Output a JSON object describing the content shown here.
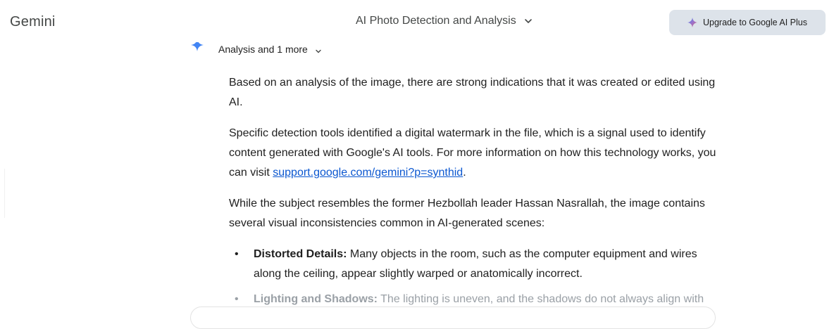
{
  "app": {
    "name": "Gemini"
  },
  "header": {
    "conversation_title": "AI Photo Detection and Analysis",
    "upgrade_label": "Upgrade to Google AI Plus"
  },
  "thinking": {
    "label": "Analysis and 1 more"
  },
  "response": {
    "p1": "Based on an analysis of the image, there are strong indications that it was created or edited using AI.",
    "p2_before": "Specific detection tools identified a digital watermark in the file, which is a signal used to identify content generated with Google's AI tools. For more information on how this technology works, you can visit ",
    "p2_link": "support.google.com/gemini?p=synthid",
    "p2_after": ".",
    "p3": "While the subject resembles the former Hezbollah leader Hassan Nasrallah, the image contains several visual inconsistencies common in AI-generated scenes:",
    "bullets": [
      {
        "title": "Distorted Details:",
        "text": " Many objects in the room, such as the computer equipment and wires along the ceiling, appear slightly warped or anatomically incorrect."
      },
      {
        "title": "Lighting and Shadows:",
        "text": " The lighting is uneven, and the shadows do not always align with"
      }
    ]
  },
  "colors": {
    "link": "#0b57d0",
    "upgrade_bg": "#dde3ea",
    "faded_text": "#9aa0a6"
  }
}
